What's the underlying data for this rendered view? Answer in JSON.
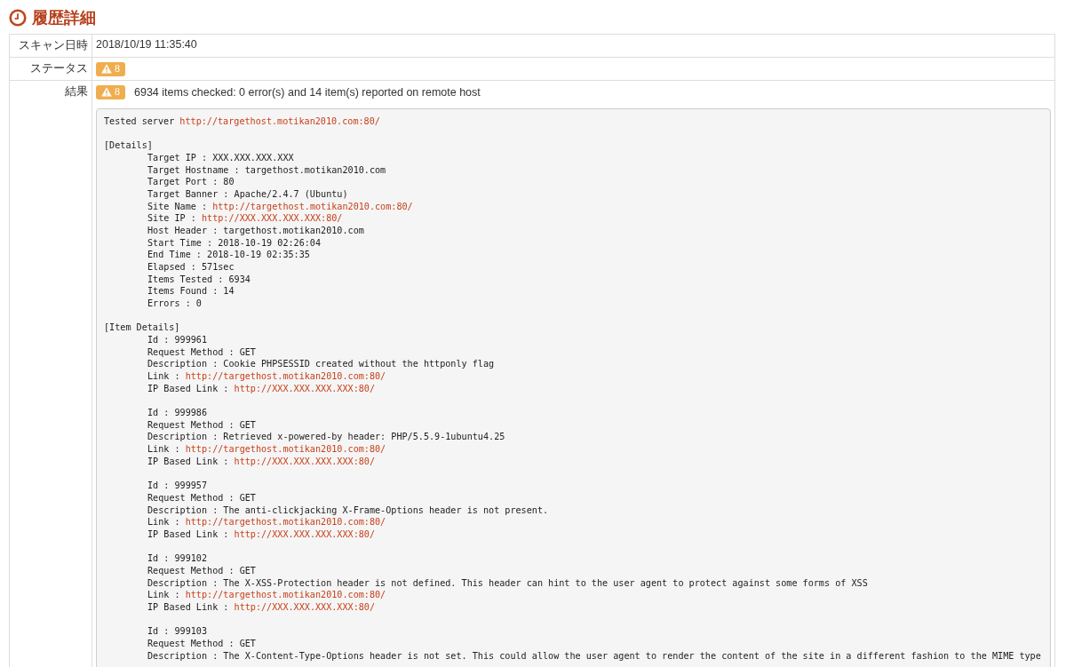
{
  "page_title": "履歴詳細",
  "rows": [
    {
      "label": "スキャン日時",
      "kind": "text",
      "value": "2018/10/19 11:35:40"
    },
    {
      "label": "ステータス",
      "kind": "badge",
      "badge": "8"
    },
    {
      "label": "結果",
      "kind": "report",
      "badge": "8",
      "summary": "6934 items checked: 0 error(s) and 14 item(s) reported on remote host",
      "report": [
        {
          "text": "Tested server ",
          "link": "http://targethost.motikan2010.com:80/",
          "indent": false
        },
        {
          "kind": "blank"
        },
        {
          "text": "[Details]",
          "indent": false
        },
        {
          "text": "Target IP : XXX.XXX.XXX.XXX",
          "indent": true
        },
        {
          "text": "Target Hostname : targethost.motikan2010.com",
          "indent": true
        },
        {
          "text": "Target Port : 80",
          "indent": true
        },
        {
          "text": "Target Banner : Apache/2.4.7 (Ubuntu)",
          "indent": true
        },
        {
          "text": "Site Name : ",
          "link": "http://targethost.motikan2010.com:80/",
          "indent": true
        },
        {
          "text": "Site IP : ",
          "link": "http://XXX.XXX.XXX.XXX:80/",
          "indent": true
        },
        {
          "text": "Host Header : targethost.motikan2010.com",
          "indent": true
        },
        {
          "text": "Start Time : 2018-10-19 02:26:04",
          "indent": true
        },
        {
          "text": "End Time : 2018-10-19 02:35:35",
          "indent": true
        },
        {
          "text": "Elapsed : 571sec",
          "indent": true
        },
        {
          "text": "Items Tested : 6934",
          "indent": true
        },
        {
          "text": "Items Found : 14",
          "indent": true
        },
        {
          "text": "Errors : 0",
          "indent": true
        },
        {
          "kind": "blank"
        },
        {
          "text": "[Item Details]",
          "indent": false
        },
        {
          "text": "Id : 999961",
          "indent": true
        },
        {
          "text": "Request Method : GET",
          "indent": true
        },
        {
          "text": "Description : Cookie PHPSESSID created without the httponly flag",
          "indent": true
        },
        {
          "text": "Link : ",
          "link": "http://targethost.motikan2010.com:80/",
          "indent": true
        },
        {
          "text": "IP Based Link : ",
          "link": "http://XXX.XXX.XXX.XXX:80/",
          "indent": true
        },
        {
          "kind": "blank"
        },
        {
          "text": "Id : 999986",
          "indent": true
        },
        {
          "text": "Request Method : GET",
          "indent": true
        },
        {
          "text": "Description : Retrieved x-powered-by header: PHP/5.5.9-1ubuntu4.25",
          "indent": true
        },
        {
          "text": "Link : ",
          "link": "http://targethost.motikan2010.com:80/",
          "indent": true
        },
        {
          "text": "IP Based Link : ",
          "link": "http://XXX.XXX.XXX.XXX:80/",
          "indent": true
        },
        {
          "kind": "blank"
        },
        {
          "text": "Id : 999957",
          "indent": true
        },
        {
          "text": "Request Method : GET",
          "indent": true
        },
        {
          "text": "Description : The anti-clickjacking X-Frame-Options header is not present.",
          "indent": true
        },
        {
          "text": "Link : ",
          "link": "http://targethost.motikan2010.com:80/",
          "indent": true
        },
        {
          "text": "IP Based Link : ",
          "link": "http://XXX.XXX.XXX.XXX:80/",
          "indent": true
        },
        {
          "kind": "blank"
        },
        {
          "text": "Id : 999102",
          "indent": true
        },
        {
          "text": "Request Method : GET",
          "indent": true
        },
        {
          "text": "Description : The X-XSS-Protection header is not defined. This header can hint to the user agent to protect against some forms of XSS",
          "indent": true
        },
        {
          "text": "Link : ",
          "link": "http://targethost.motikan2010.com:80/",
          "indent": true
        },
        {
          "text": "IP Based Link : ",
          "link": "http://XXX.XXX.XXX.XXX:80/",
          "indent": true
        },
        {
          "kind": "blank"
        },
        {
          "text": "Id : 999103",
          "indent": true
        },
        {
          "text": "Request Method : GET",
          "indent": true
        },
        {
          "text": "Description : The X-Content-Type-Options header is not set. This could allow the user agent to render the content of the site in a different fashion to the MIME type",
          "indent": true
        }
      ]
    }
  ]
}
